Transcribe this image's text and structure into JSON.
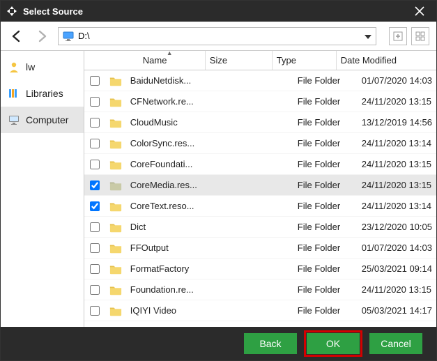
{
  "window": {
    "title": "Select Source"
  },
  "path": {
    "text": "D:\\"
  },
  "sidebar": {
    "items": [
      {
        "label": "lw"
      },
      {
        "label": "Libraries"
      },
      {
        "label": "Computer"
      }
    ]
  },
  "columns": {
    "name": "Name",
    "size": "Size",
    "type": "Type",
    "date": "Date Modified"
  },
  "rows": [
    {
      "checked": false,
      "name": "BaiduNetdisk...",
      "size": "",
      "type": "File Folder",
      "date": "01/07/2020 14:03",
      "selected": false
    },
    {
      "checked": false,
      "name": "CFNetwork.re...",
      "size": "",
      "type": "File Folder",
      "date": "24/11/2020 13:15",
      "selected": false
    },
    {
      "checked": false,
      "name": "CloudMusic",
      "size": "",
      "type": "File Folder",
      "date": "13/12/2019 14:56",
      "selected": false
    },
    {
      "checked": false,
      "name": "ColorSync.res...",
      "size": "",
      "type": "File Folder",
      "date": "24/11/2020 13:14",
      "selected": false
    },
    {
      "checked": false,
      "name": "CoreFoundati...",
      "size": "",
      "type": "File Folder",
      "date": "24/11/2020 13:15",
      "selected": false
    },
    {
      "checked": true,
      "name": "CoreMedia.res...",
      "size": "",
      "type": "File Folder",
      "date": "24/11/2020 13:15",
      "selected": true
    },
    {
      "checked": true,
      "name": "CoreText.reso...",
      "size": "",
      "type": "File Folder",
      "date": "24/11/2020 13:14",
      "selected": false
    },
    {
      "checked": false,
      "name": "Dict",
      "size": "",
      "type": "File Folder",
      "date": "23/12/2020 10:05",
      "selected": false
    },
    {
      "checked": false,
      "name": "FFOutput",
      "size": "",
      "type": "File Folder",
      "date": "01/07/2020 14:03",
      "selected": false
    },
    {
      "checked": false,
      "name": "FormatFactory",
      "size": "",
      "type": "File Folder",
      "date": "25/03/2021 09:14",
      "selected": false
    },
    {
      "checked": false,
      "name": "Foundation.re...",
      "size": "",
      "type": "File Folder",
      "date": "24/11/2020 13:15",
      "selected": false
    },
    {
      "checked": false,
      "name": "IQIYI Video",
      "size": "",
      "type": "File Folder",
      "date": "05/03/2021 14:17",
      "selected": false
    }
  ],
  "footer": {
    "back": "Back",
    "ok": "OK",
    "cancel": "Cancel"
  }
}
